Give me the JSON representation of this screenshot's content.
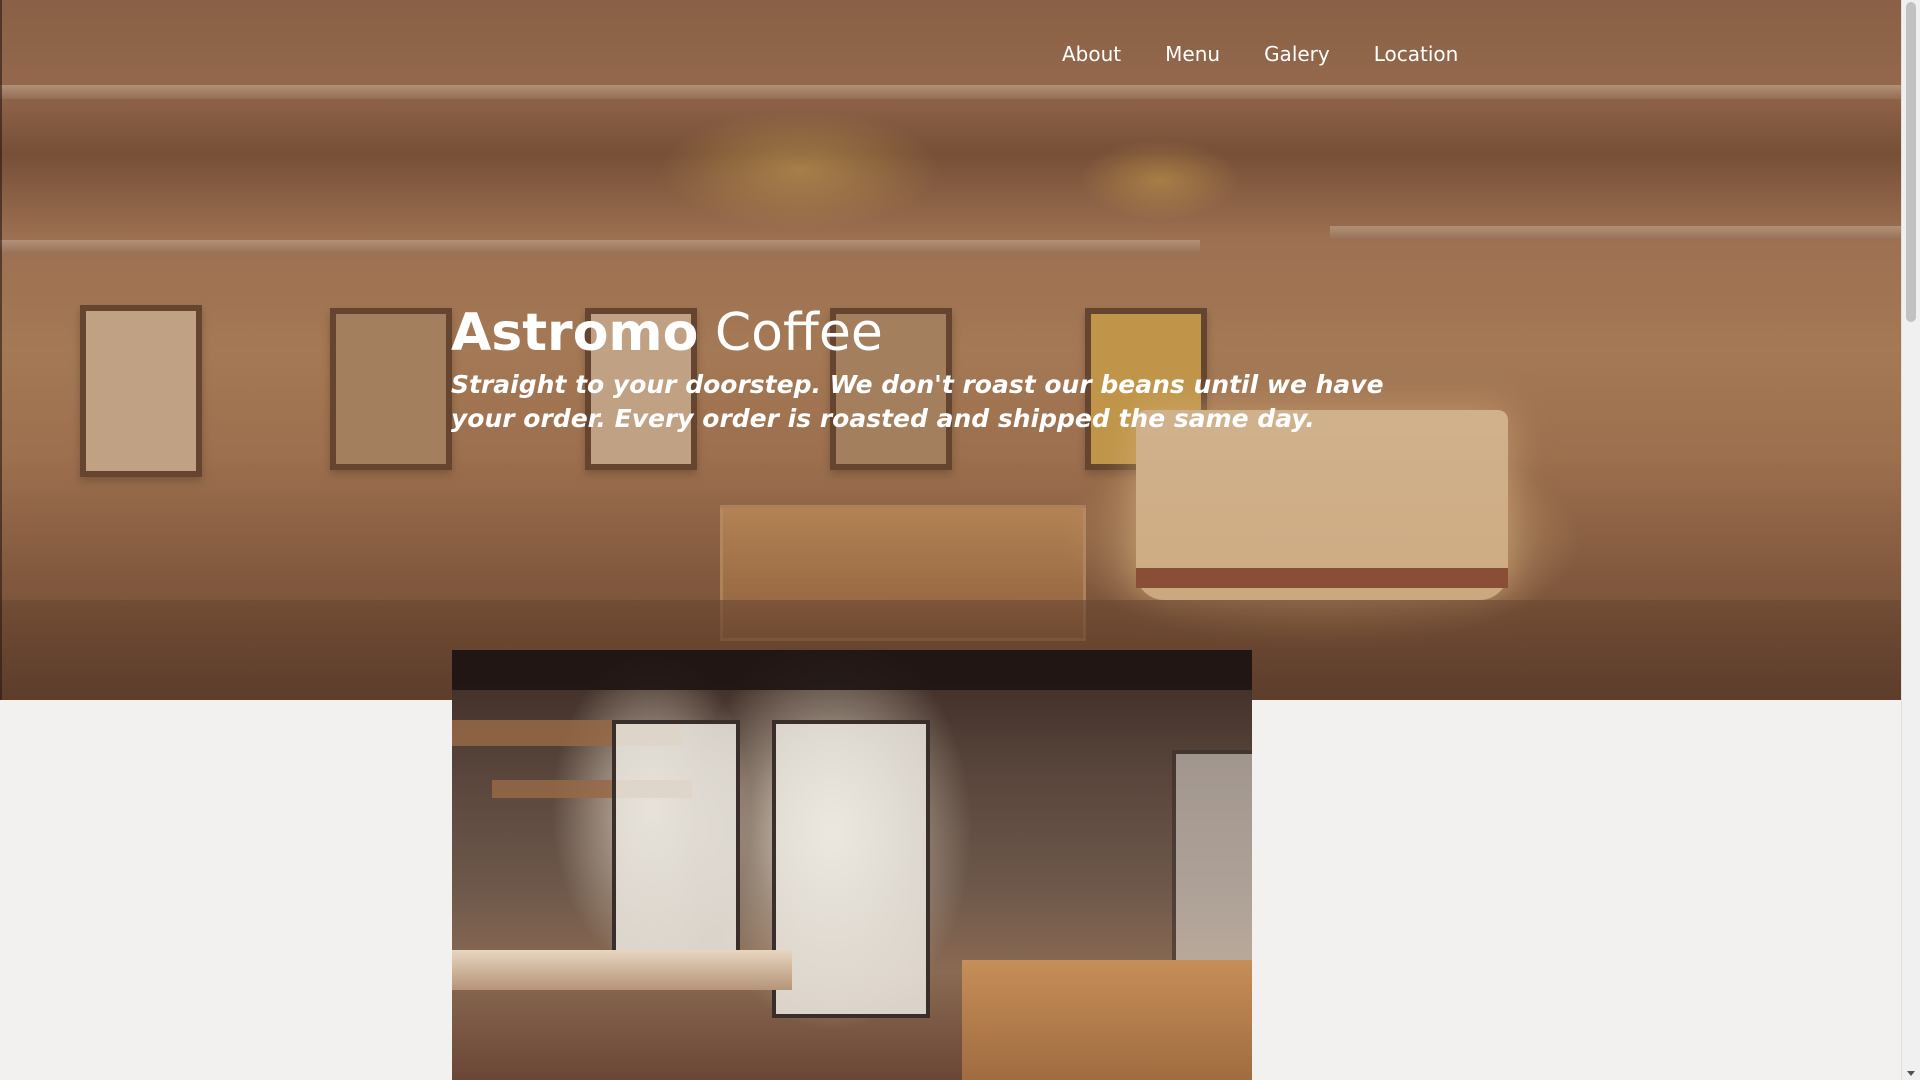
{
  "nav": {
    "links": [
      {
        "label": "About"
      },
      {
        "label": "Menu"
      },
      {
        "label": "Galery"
      },
      {
        "label": "Location"
      }
    ]
  },
  "hero": {
    "title_bold": "Astromo",
    "title_light": "Coffee",
    "tagline": "Straight to your doorstep. We don't roast our beans until we have your order. Every order is roasted and shipped the same day."
  },
  "colors": {
    "hero_overlay": "#a06c48",
    "page_background": "#f2f1f0",
    "text_on_hero": "#ffffff"
  },
  "icons": {
    "scroll_down": "chevron-down-icon"
  }
}
